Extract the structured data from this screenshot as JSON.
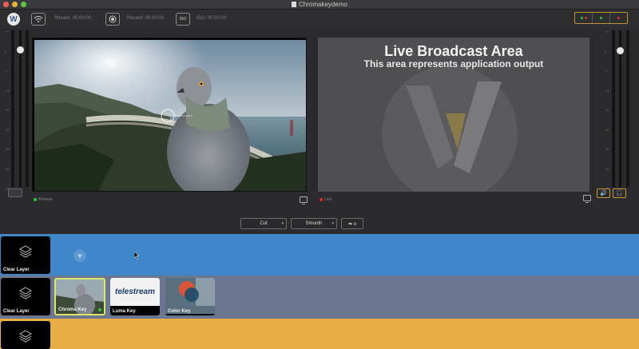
{
  "window": {
    "title": "Chromakeydemo"
  },
  "toolbar": {
    "logo_letter": "W",
    "stream_label": "Stream:",
    "stream_time": "00:00:00",
    "record_label": "Record:",
    "record_time": "00:00:00",
    "iso_label": "ISO:",
    "iso_time": "00:00:00",
    "iso_icon_text": "ISO"
  },
  "preview": {
    "label": "Preview"
  },
  "live": {
    "label": "Live",
    "title": "Live Broadcast Area",
    "subtitle": "This area represents application output"
  },
  "meter_scale": [
    "+6",
    "0",
    "-6",
    "-12",
    "-20",
    "-30",
    "-40",
    "-50",
    "-60"
  ],
  "transition": {
    "type_value": "Cut",
    "style_value": "Smooth",
    "go_symbol": "➡ o"
  },
  "layers": {
    "top": {
      "color": "#3f86c8",
      "clear_label": "Clear Layer",
      "add_symbol": "+"
    },
    "middle": {
      "color": "#6b7690",
      "clear_label": "Clear Layer",
      "items": [
        {
          "label": "Chroma Key",
          "selected": true
        },
        {
          "label": "Luma Key",
          "brand": "telestream"
        },
        {
          "label": "Color Key"
        }
      ]
    },
    "bottom": {
      "color": "#e8ad45"
    }
  },
  "colors": {
    "accent_gold": "#c89a30",
    "tally_green": "#3ac23a",
    "tally_red": "#e02a2a",
    "selected_outline": "#d8e66a"
  },
  "icons": {
    "wifi": "wifi-icon",
    "record": "record-icon",
    "iso": "iso-icon",
    "speaker": "speaker-icon",
    "headphones": "headphones-icon",
    "monitor": "monitor-icon",
    "layers": "layers-icon"
  }
}
